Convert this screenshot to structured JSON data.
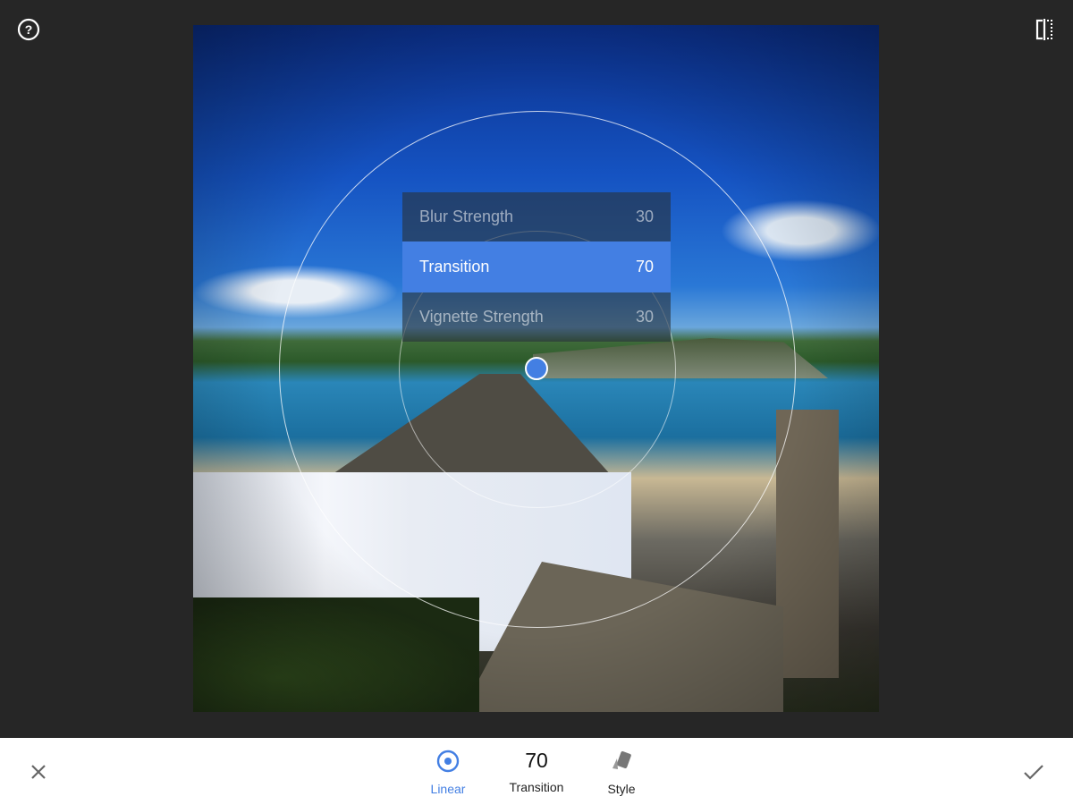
{
  "toolbar_top": {
    "help_icon": "help-circle-icon",
    "compare_icon": "compare-split-icon"
  },
  "adjust_panel": {
    "items": [
      {
        "label": "Blur Strength",
        "value": "30"
      },
      {
        "label": "Transition",
        "value": "70"
      },
      {
        "label": "Vignette Strength",
        "value": "30"
      }
    ],
    "selected": "Transition"
  },
  "bottom_bar": {
    "cancel_icon": "close-icon",
    "apply_icon": "check-icon",
    "linear_label": "Linear",
    "current_value": "70",
    "current_param": "Transition",
    "style_label": "Style"
  },
  "colors": {
    "accent": "#437fe3",
    "background": "#262626",
    "bar": "#ffffff"
  }
}
